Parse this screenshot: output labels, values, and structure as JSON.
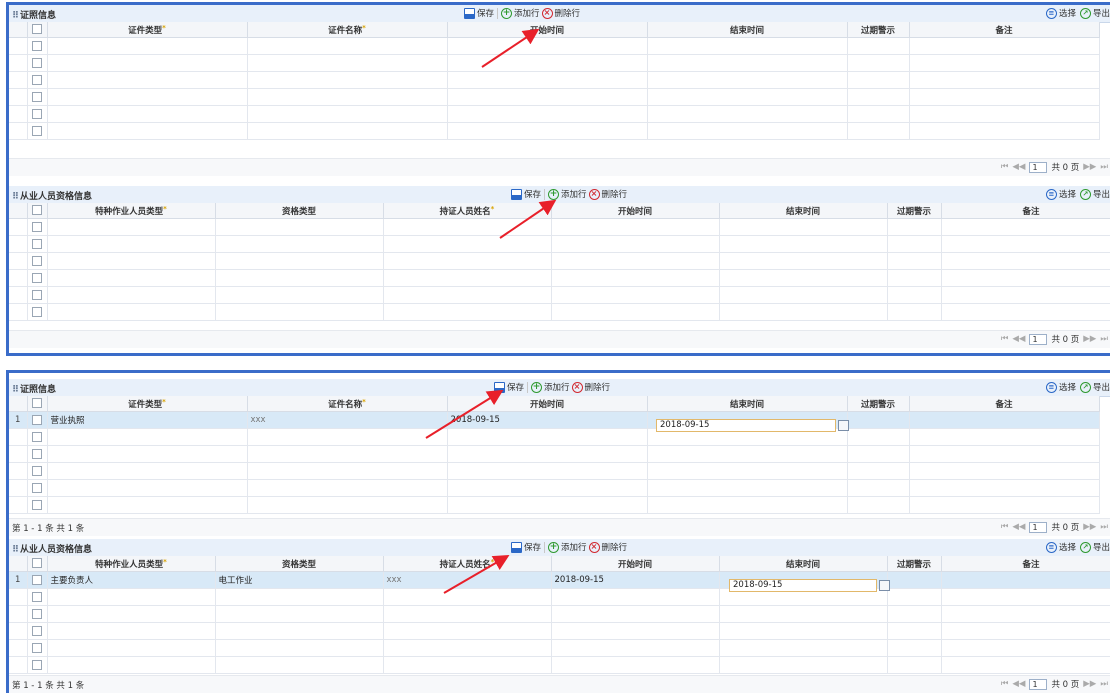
{
  "toolbar": {
    "save": "保存",
    "add": "添加行",
    "delete": "删除行",
    "select": "选择",
    "export": "导出"
  },
  "cert_section": {
    "title": "证照信息",
    "columns": [
      "证件类型",
      "证件名称",
      "开始时间",
      "结束时间",
      "过期警示",
      "备注"
    ],
    "required": [
      true,
      true,
      false,
      false,
      false,
      false
    ]
  },
  "qual_section": {
    "title": "从业人员资格信息",
    "columns": [
      "特种作业人员类型",
      "资格类型",
      "持证人员姓名",
      "开始时间",
      "结束时间",
      "过期警示",
      "备注"
    ],
    "required": [
      true,
      false,
      true,
      false,
      false,
      false,
      false
    ]
  },
  "pager": {
    "first": "⏮",
    "prev": "◀◀",
    "page": "1",
    "total": "共 0 页",
    "next": "▶▶",
    "last": "⏭"
  },
  "shot2": {
    "cert_row": {
      "index": "1",
      "cert_type": "营业执照",
      "cert_name": "xxx",
      "start": "2018-09-15",
      "end": "2018-09-15"
    },
    "cert_footer": "第 1 - 1 条  共 1 条",
    "qual_row": {
      "index": "1",
      "worker_type": "主要负责人",
      "qual_type": "电工作业",
      "holder": "xxx",
      "start": "2018-09-15",
      "end": "2018-09-15"
    },
    "qual_footer": "第 1 - 1 条  共 1 条"
  },
  "colors": {
    "border": "#3a6cc9",
    "header_bg": "#e8f0fa",
    "selected_row": "#d8e9f7",
    "arrow": "#e8202a"
  }
}
